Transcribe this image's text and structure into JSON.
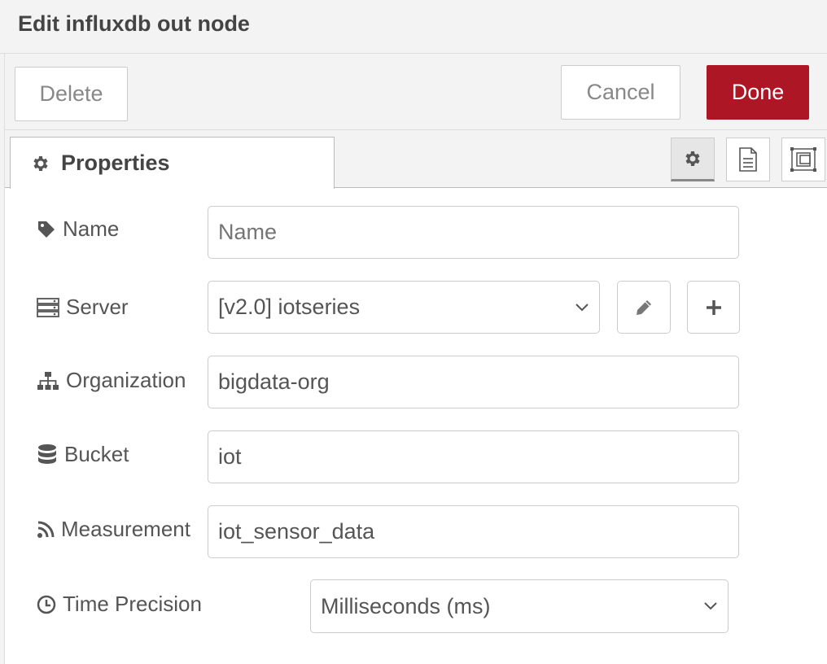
{
  "dialog": {
    "title": "Edit influxdb out node"
  },
  "buttons": {
    "delete": "Delete",
    "cancel": "Cancel",
    "done": "Done"
  },
  "tabs": {
    "properties": "Properties"
  },
  "colors": {
    "done": "#ad1625",
    "text": "#555555"
  },
  "fields": {
    "name": {
      "label": "Name",
      "placeholder": "Name",
      "value": ""
    },
    "server": {
      "label": "Server",
      "value": "[v2.0] iotseries"
    },
    "organization": {
      "label": "Organization",
      "value": "bigdata-org"
    },
    "bucket": {
      "label": "Bucket",
      "value": "iot"
    },
    "measurement": {
      "label": "Measurement",
      "value": "iot_sensor_data"
    },
    "time_precision": {
      "label": "Time Precision",
      "value": "Milliseconds (ms)"
    }
  },
  "icons": [
    "gear-icon",
    "tag-icon",
    "server-icon",
    "sitemap-icon",
    "database-icon",
    "rss-icon",
    "clock-icon",
    "pencil-icon",
    "plus-icon",
    "description-icon",
    "appearance-icon",
    "chevron-down-icon"
  ]
}
